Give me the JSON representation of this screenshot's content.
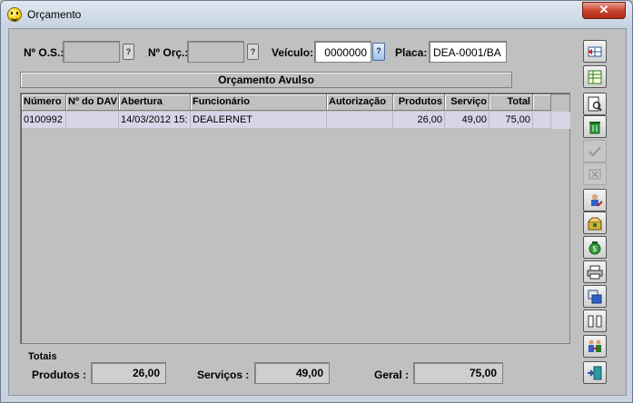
{
  "window": {
    "title": "Orçamento",
    "close_label": "✕"
  },
  "header": {
    "os_label": "Nº O.S.:",
    "os_value": "",
    "orc_label": "Nº Orç.:",
    "orc_value": "",
    "veiculo_label": "Veículo:",
    "veiculo_value": "0000000",
    "placa_label": "Placa:",
    "placa_value": "DEA-0001/BA"
  },
  "section": {
    "title": "Orçamento Avulso"
  },
  "table": {
    "columns": [
      "Número",
      "Nº do DAV",
      "Abertura",
      "Funcionário",
      "Autorização",
      "Produtos",
      "Serviço",
      "Total"
    ],
    "rows": [
      [
        "0100992",
        "",
        "14/03/2012  15:",
        "DEALERNET",
        "",
        "26,00",
        "49,00",
        "75,00"
      ]
    ]
  },
  "totals": {
    "title": "Totais",
    "produtos_label": "Produtos :",
    "produtos_value": "26,00",
    "servicos_label": "Serviços :",
    "servicos_value": "49,00",
    "geral_label": "Geral :",
    "geral_value": "75,00"
  },
  "toolbar": [
    {
      "icon": "new-line-icon"
    },
    {
      "icon": "grid-add-icon"
    },
    {
      "icon": "preview-icon"
    },
    {
      "icon": "trash-icon"
    },
    {
      "icon": "check-icon",
      "disabled": true
    },
    {
      "icon": "cancel-icon",
      "disabled": true
    },
    {
      "icon": "edit-person-icon"
    },
    {
      "icon": "box-icon"
    },
    {
      "icon": "money-bag-icon"
    },
    {
      "icon": "print-icon"
    },
    {
      "icon": "copy-icon"
    },
    {
      "icon": "columns-icon"
    },
    {
      "icon": "transfer-icon"
    },
    {
      "icon": "exit-door-icon"
    }
  ]
}
